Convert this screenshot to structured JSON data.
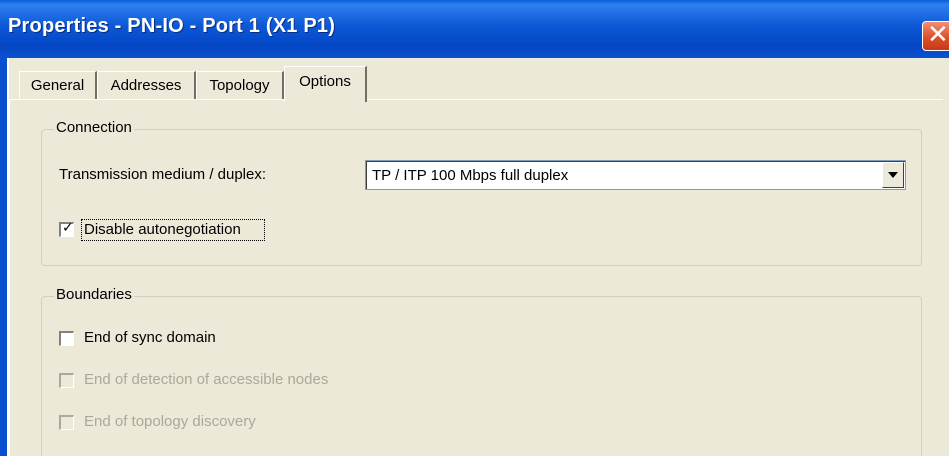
{
  "window": {
    "title": "Properties - PN-IO - Port 1 (X1 P1)",
    "close_glyph": "✕"
  },
  "tabs": [
    {
      "label": "General",
      "active": false
    },
    {
      "label": "Addresses",
      "active": false
    },
    {
      "label": "Topology",
      "active": false
    },
    {
      "label": "Options",
      "active": true
    }
  ],
  "connection": {
    "group_title": "Connection",
    "medium_label": "Transmission medium / duplex:",
    "medium_value": "TP / ITP 100 Mbps full duplex",
    "disable_autoneg_label": "Disable autonegotiation",
    "disable_autoneg_checked": true,
    "check_glyph": "✓"
  },
  "boundaries": {
    "group_title": "Boundaries",
    "items": [
      {
        "label": "End of sync domain",
        "checked": false,
        "enabled": true
      },
      {
        "label": "End of detection of accessible nodes",
        "checked": false,
        "enabled": false
      },
      {
        "label": "End of topology discovery",
        "checked": false,
        "enabled": false
      }
    ]
  },
  "colors": {
    "title_bar": "#0a51cf",
    "dialog_bg": "#ece9d8",
    "close_button": "#de4f2c",
    "disabled_text": "#aca899"
  },
  "icons": [
    "close-icon",
    "dropdown-arrow-icon",
    "checkmark-icon"
  ]
}
